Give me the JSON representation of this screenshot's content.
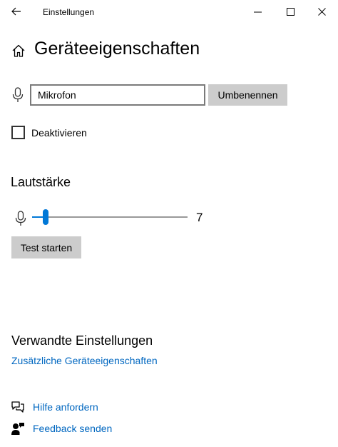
{
  "window": {
    "title": "Einstellungen",
    "back_icon": "arrow-left-icon",
    "controls": [
      "minimize-icon",
      "maximize-icon",
      "close-icon"
    ]
  },
  "header": {
    "icon": "home-icon",
    "title": "Geräteeigenschaften"
  },
  "device": {
    "icon": "microphone-icon",
    "name_value": "Mikrofon",
    "rename_label": "Umbenennen"
  },
  "disable": {
    "label": "Deaktivieren",
    "checked": false
  },
  "volume": {
    "heading": "Lautstärke",
    "icon": "microphone-icon",
    "value": "7",
    "level_percent": 7
  },
  "test": {
    "label": "Test starten"
  },
  "related": {
    "heading": "Verwandte Einstellungen",
    "link_label": "Zusätzliche Geräteeigenschaften"
  },
  "help": {
    "get_help_label": "Hilfe anfordern",
    "get_help_icon": "chat-help-icon",
    "feedback_label": "Feedback senden",
    "feedback_icon": "feedback-person-icon"
  },
  "colors": {
    "accent": "#0078d7",
    "link": "#0067c0",
    "button_bg": "#cccccc"
  }
}
